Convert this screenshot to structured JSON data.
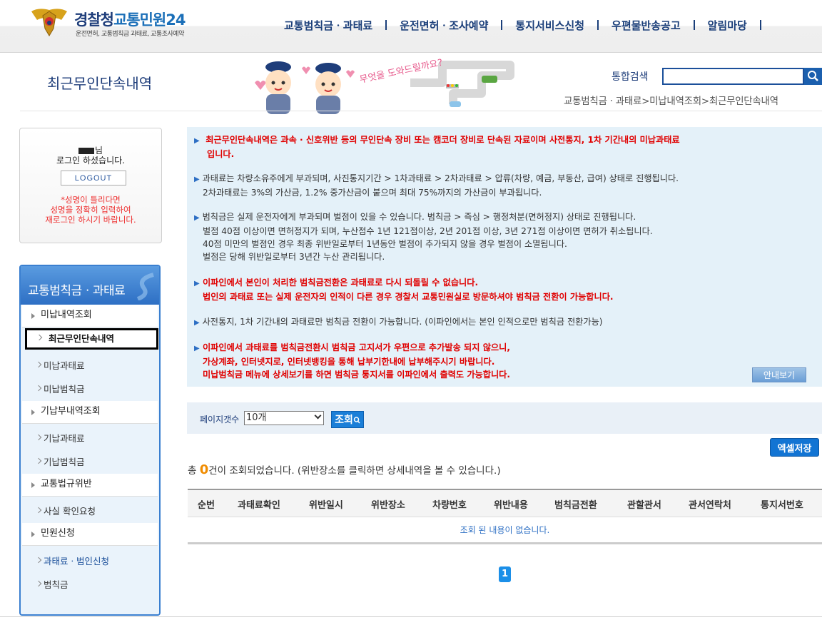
{
  "header": {
    "logo_title_a": "경찰청",
    "logo_title_b": "교통민원24",
    "logo_subtitle": "운전면허, 교통범칙금 과태료, 교통조사예약",
    "nav": [
      "교통범칙금ㆍ과태료",
      "운전면허ㆍ조사예약",
      "통지서비스신청",
      "우편물반송공고",
      "알림마당"
    ]
  },
  "page": {
    "title": "최근무인단속내역",
    "illus_text": "무엇을 도와드릴까요?",
    "search_label": "통합검색",
    "search_value": "",
    "breadcrumb": "교통범칙금ㆍ과태료>미납내역조회>최근무인단속내역"
  },
  "login": {
    "name_suffix": "님",
    "message": "로그인 하셨습니다.",
    "logout_label": "LOGOUT",
    "warn_line1": "*성명이 틀리다면",
    "warn_line2": "성명을 정확히 입력하여",
    "warn_line3": "재로그인 하시기 바랍니다."
  },
  "sidemenu": {
    "title": "교통범칙금ㆍ과태료",
    "items": [
      {
        "label": "미납내역조회",
        "level": 1
      },
      {
        "label": "최근무인단속내역",
        "level": 2,
        "active": true
      },
      {
        "label": "미납과태료",
        "level": 2
      },
      {
        "label": "미납범칙금",
        "level": 2
      },
      {
        "label": "기납부내역조회",
        "level": 1
      },
      {
        "label": "기납과태료",
        "level": 2
      },
      {
        "label": "기납범칙금",
        "level": 2
      },
      {
        "label": "교통법규위반",
        "level": 1
      },
      {
        "label": "사실 확인요청",
        "level": 2
      },
      {
        "label": "민원신청",
        "level": 1
      },
      {
        "label": "과태료ㆍ범인신청",
        "level": 2
      },
      {
        "label": "범칙금",
        "level": 2
      }
    ]
  },
  "info": {
    "p1_l1": "최근무인단속내역은 과속 · 신호위반 등의 무인단속 장비 또는 캠코더 장비로 단속된 자료이며 사전통지, 1차 기간내의 미납과태료",
    "p1_l2": "입니다.",
    "p2_l1": "과태료는 차량소유주에게 부과되며, 사진통지기간 > 1차과태료 > 2차과태료 > 압류(차량, 예금, 부동산, 급여) 상태로 진행됩니다.",
    "p2_l2": "2차과태료는 3%의 가산금, 1.2% 중가산금이 붙으며 최대 75%까지의 가산금이 부과됩니다.",
    "p3_l1": "범칙금은 실제 운전자에게 부과되며 벌점이 있을 수 있습니다. 범칙금 > 즉심 > 행정처분(면허정지) 상태로 진행됩니다.",
    "p3_l2": "벌점 40점 이상이면 면허정지가 되며, 누산점수 1년 121점이상, 2년 201점 이상, 3년 271점 이상이면 면허가 취소됩니다.",
    "p3_l3": "40점 미만의 벌점인 경우 최종 위반일로부터 1년동안 벌점이 추가되지 않을 경우 벌점이 소멸됩니다.",
    "p3_l4": "벌점은 당해 위반일로부터 3년간 누산 관리됩니다.",
    "p4_l1": "이파인에서 본인이 처리한 범칙금전환은 과태료로 다시 되돌릴 수 없습니다.",
    "p4_l2": "법인의 과태료 또는 실제 운전자의 인적이 다른 경우 경찰서 교통민원실로 방문하셔야 범칙금 전환이 가능합니다.",
    "p5_l1": "사전통지, 1차 기간내의 과태료만 범칙금 전환이 가능합니다. (이파인에서는 본인 인적으로만 범칙금 전환가능)",
    "p6_l1": "이파인에서 과태료를 범칙금전환시 범칙금 고지서가 우편으로 추가발송 되지 않으니,",
    "p6_l2": "가상계좌, 인터넷지로, 인터넷뱅킹을 통해 납부기한내에 납부해주시기 바랍니다.",
    "p6_l3": "미납범칙금 메뉴에 상세보기를 하면 범칙금 통지서를 이파인에서 출력도 가능합니다.",
    "guide_label": "안내보기"
  },
  "controls": {
    "pagesize_label": "페이지갯수",
    "pagesize_value": "10개",
    "search_label": "조회",
    "excel_label": "엑셀저장"
  },
  "result": {
    "prefix": "총 ",
    "count": "0",
    "suffix": "건이 조회되었습니다. (위반장소를 클릭하면 상세내역을 볼 수 있습니다.)"
  },
  "table": {
    "headers": [
      "순번",
      "과태료확인",
      "위반일시",
      "위반장소",
      "차량번호",
      "위반내용",
      "범칙금전환",
      "관할관서",
      "관서연락처",
      "통지서번호"
    ],
    "empty_message": "조회 된 내용이 없습니다."
  },
  "pager": {
    "current": "1"
  },
  "colors": {
    "brand_navy": "#1e3d7a",
    "accent_blue": "#1b7fd8",
    "warn_red": "#e00000",
    "info_bg": "#e4f1f9",
    "count_orange": "#f08c00"
  }
}
